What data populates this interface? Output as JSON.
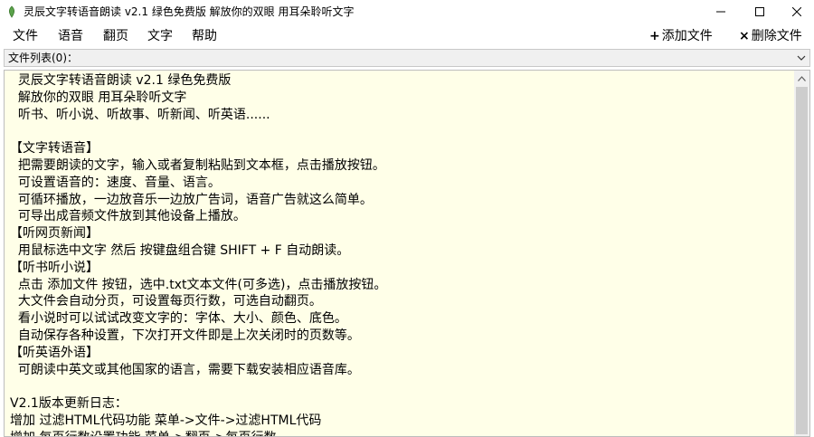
{
  "window": {
    "title": "灵辰文字转语音朗读 v2.1 绿色免费版 解放你的双眼 用耳朵聆听文字"
  },
  "menu": {
    "items": [
      "文件",
      "语音",
      "翻页",
      "文字",
      "帮助"
    ]
  },
  "toolbar": {
    "add_file_label": "添加文件",
    "delete_file_label": "删除文件"
  },
  "file_list": {
    "label": "文件列表(0)："
  },
  "editor": {
    "lines": [
      "  灵辰文字转语音朗读 v2.1 绿色免费版",
      "  解放你的双眼 用耳朵聆听文字",
      "  听书、听小说、听故事、听新闻、听英语......",
      "",
      "【文字转语音】",
      "  把需要朗读的文字，输入或者复制粘贴到文本框，点击播放按钮。",
      "  可设置语音的：速度、音量、语言。",
      "  可循环播放，一边放音乐一边放广告词，语音广告就这么简单。",
      "  可导出成音频文件放到其他设备上播放。",
      "【听网页新闻】",
      "  用鼠标选中文字 然后 按键盘组合键 SHIFT + F 自动朗读。",
      "【听书听小说】",
      "  点击 添加文件 按钮，选中.txt文本文件(可多选)，点击播放按钮。",
      "  大文件会自动分页，可设置每页行数，可选自动翻页。",
      "  看小说时可以试试改变文字的：字体、大小、颜色、底色。",
      "  自动保存各种设置，下次打开文件即是上次关闭时的页数等。",
      "【听英语外语】",
      "  可朗读中英文或其他国家的语言，需要下载安装相应语音库。",
      "",
      "V2.1版本更新日志：",
      "增加 过滤HTML代码功能 菜单->文件->过滤HTML代码",
      "增加 每页行数设置功能 菜单->翻页->每页行数"
    ]
  }
}
